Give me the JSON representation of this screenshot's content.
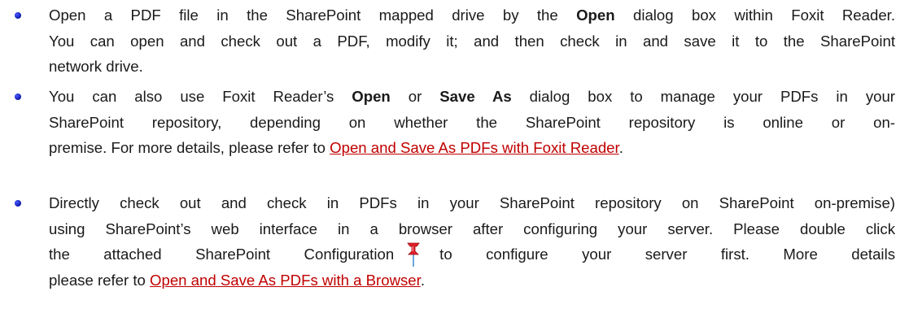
{
  "bullets": [
    {
      "lines": [
        {
          "t1": "Open a PDF file in the SharePoint mapped drive by the ",
          "b1": "Open",
          "t2": " dialog box within Foxit Reader."
        },
        {
          "text": "You can open and check out a PDF, modify it; and then check in and save it to the SharePoint"
        },
        {
          "text": "network drive."
        }
      ]
    },
    {
      "lines": [
        {
          "t1": "You can also use Foxit Reader’s ",
          "b1": "Open",
          "t2": " or ",
          "b2": "Save As",
          "t3": " dialog box to manage your PDFs in your"
        },
        {
          "text": "SharePoint repository, depending on whether the SharePoint repository is online or on-"
        },
        {
          "text": "premise. For more details, please refer to ",
          "link": "Open and Save As PDFs with Foxit Reader",
          "tail": "."
        }
      ]
    },
    {
      "lines": [
        {
          "text": "Directly check out and check in PDFs in your SharePoint repository on SharePoint on-premise)"
        },
        {
          "text": "using SharePoint’s web interface in a browser after configuring your server. Please double click"
        },
        {
          "t1": "the attached SharePoint Configuration",
          "t2": "to configure your server first. More details"
        },
        {
          "text": "please refer to ",
          "link": "Open and Save As PDFs with a Browser",
          "tail": "."
        }
      ]
    }
  ],
  "icons": {
    "attachment": "pushpin-attachment-icon",
    "bullet": "bullet-dot-icon"
  },
  "colors": {
    "link": "#c00000",
    "bullet": "#0a14a8",
    "text": "#1a1a1a",
    "pin": "#e0202a"
  }
}
